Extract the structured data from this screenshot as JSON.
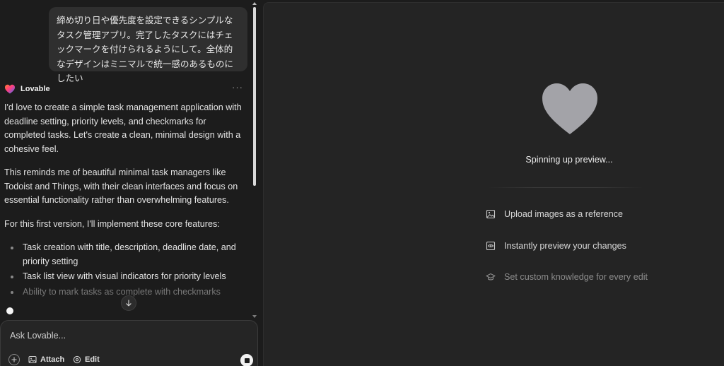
{
  "user_message": {
    "text": "締め切り日や優先度を設定できるシンプルなタスク管理アプリ。完了したタスクにはチェックマークを付けられるようにして。全体的なデザインはミニマルで統一感のあるものにしたい"
  },
  "assistant": {
    "name": "Lovable",
    "more_label": "···",
    "paragraphs": [
      "I'd love to create a simple task management application with deadline setting, priority levels, and checkmarks for completed tasks. Let's create a clean, minimal design with a cohesive feel.",
      "This reminds me of beautiful minimal task managers like Todoist and Things, with their clean interfaces and focus on essential functionality rather than overwhelming features.",
      "For this first version, I'll implement these core features:"
    ],
    "features": [
      "Task creation with title, description, deadline date, and priority setting",
      "Task list view with visual indicators for priority levels",
      "Ability to mark tasks as complete with checkmarks"
    ]
  },
  "composer": {
    "placeholder": "Ask Lovable...",
    "attach_label": "Attach",
    "edit_label": "Edit"
  },
  "preview": {
    "status": "Spinning up preview...",
    "tips": [
      "Upload images as a reference",
      "Instantly preview your changes",
      "Set custom knowledge for every edit"
    ]
  },
  "colors": {
    "background": "#1c1c1c",
    "panel": "#242424",
    "bubble": "#2f2f2f",
    "heart": "#a3a3a8",
    "logo_gradient": [
      "#ff6a3d",
      "#ff3d7f",
      "#4d7cff"
    ]
  }
}
